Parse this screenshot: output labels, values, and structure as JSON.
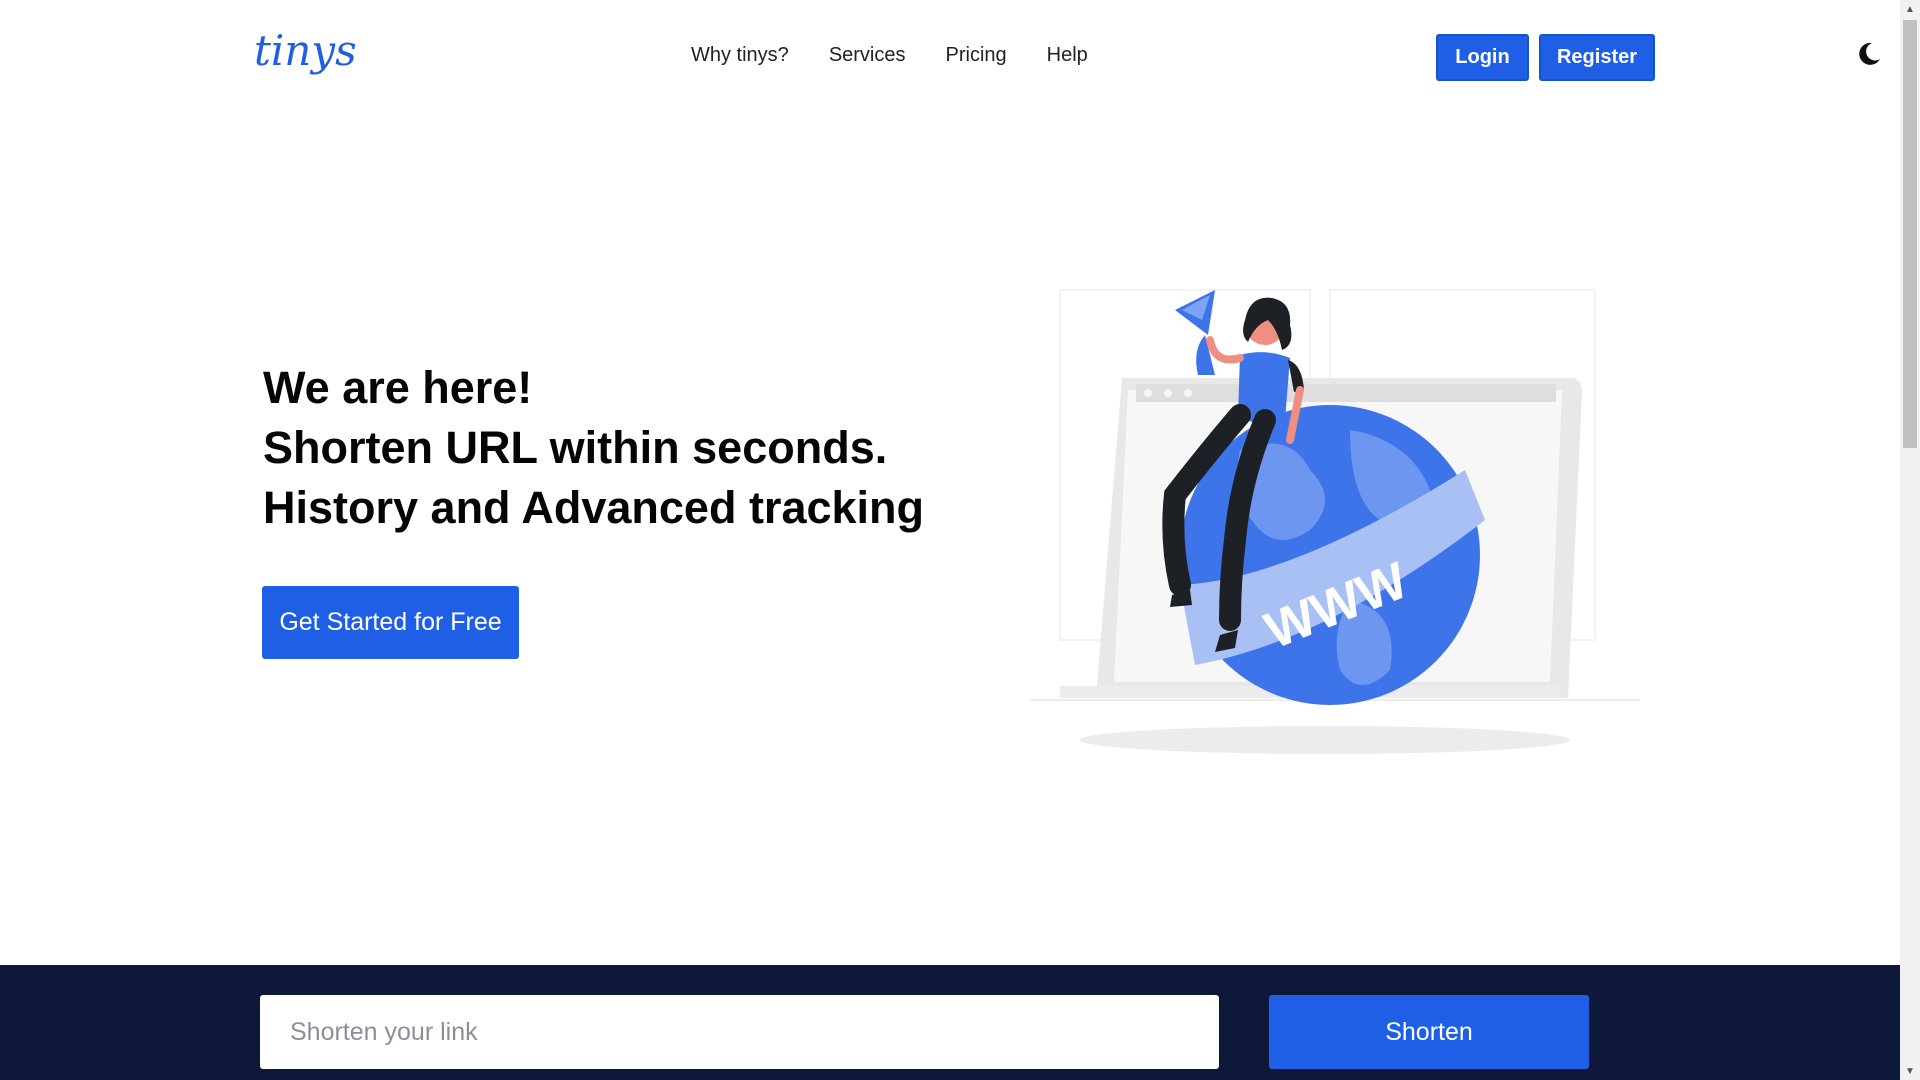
{
  "brand": {
    "logo_text": "tinys",
    "accent_color": "#1e5fe6"
  },
  "nav": {
    "items": [
      {
        "label": "Why tinys?"
      },
      {
        "label": "Services"
      },
      {
        "label": "Pricing"
      },
      {
        "label": "Help"
      }
    ]
  },
  "auth": {
    "login_label": "Login",
    "register_label": "Register"
  },
  "theme_toggle": {
    "icon": "moon-icon"
  },
  "hero": {
    "lines": [
      "We are here!",
      "Shorten URL within seconds.",
      "History and Advanced tracking"
    ],
    "cta_label": "Get Started for Free",
    "illustration_text": "WWW"
  },
  "shortener": {
    "placeholder": "Shorten your link",
    "value": "",
    "button_label": "Shorten",
    "bar_color": "#0d1738"
  }
}
